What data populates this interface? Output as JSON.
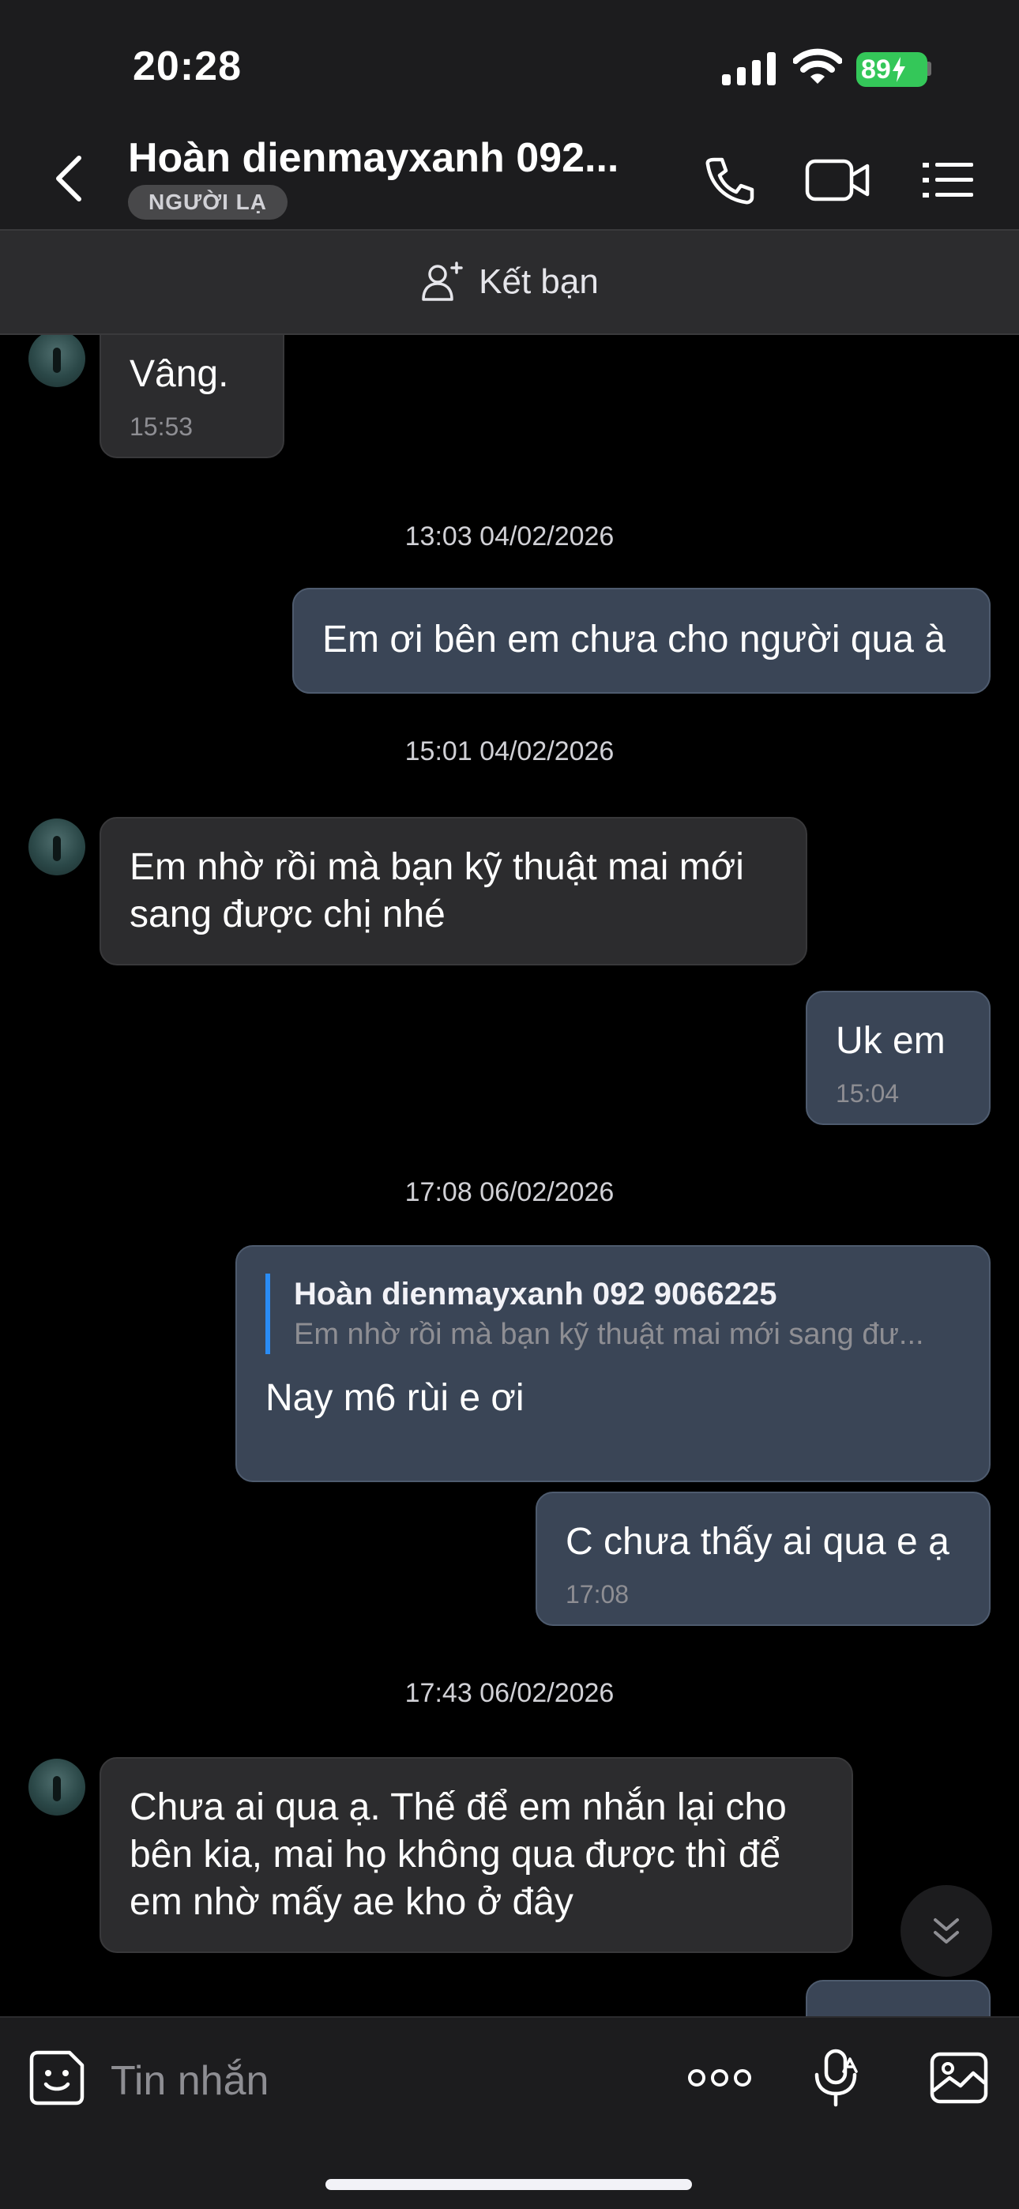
{
  "status_bar": {
    "time": "20:28",
    "battery": "89"
  },
  "header": {
    "contact_name": "Hoàn dienmayxanh 092...",
    "badge": "NGƯỜI LẠ",
    "icons": [
      "back-icon",
      "phone-icon",
      "video-camera-icon",
      "menu-list-icon"
    ]
  },
  "add_friend": {
    "label": "Kết bạn",
    "icon": "add-person-icon"
  },
  "messages": [
    {
      "dir": "in",
      "text": "Vâng.",
      "time": "15:53"
    },
    {
      "type": "date",
      "text": "13:03 04/02/2026"
    },
    {
      "dir": "out",
      "text": "Em ơi bên em chưa cho người qua à"
    },
    {
      "type": "date",
      "text": "15:01 04/02/2026"
    },
    {
      "dir": "in",
      "text": "Em nhờ rồi mà bạn kỹ thuật mai mới sang được chị nhé"
    },
    {
      "dir": "out",
      "text": "Uk em",
      "time": "15:04"
    },
    {
      "type": "date",
      "text": "17:08 06/02/2026"
    },
    {
      "dir": "out",
      "reply_to": {
        "name": "Hoàn dienmayxanh 092 9066225",
        "text": "Em nhờ rồi mà bạn kỹ thuật mai mới sang đư..."
      },
      "text": "Nay m6 rùi e ơi"
    },
    {
      "dir": "out",
      "text": "C chưa thấy ai qua e ạ",
      "time": "17:08"
    },
    {
      "type": "date",
      "text": "17:43 06/02/2026"
    },
    {
      "dir": "in",
      "text": "Chưa ai qua ạ. Thế để em nhắn lại cho bên kia, mai họ không qua được thì để em nhờ mấy ae kho ở đây"
    }
  ],
  "input_bar": {
    "placeholder": "Tin nhắn",
    "icons": [
      "sticker-icon",
      "more-dots-icon",
      "voice-to-text-icon",
      "image-icon"
    ]
  },
  "colors": {
    "outgoing_bubble": "#3a4556",
    "incoming_bubble": "#2c2c2e",
    "quote_bar": "#2a8cf5",
    "battery": "#34c759"
  }
}
